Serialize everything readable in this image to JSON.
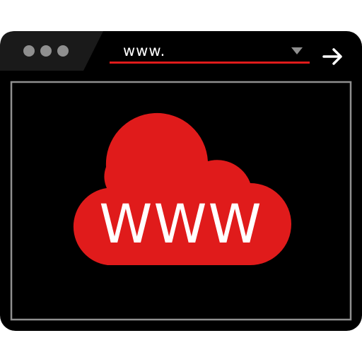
{
  "address_bar": {
    "url_value": "www.",
    "dropdown_icon": "triangle-down-icon",
    "go_icon": "arrow-right-icon"
  },
  "window_controls": {
    "icon": "three-dots-icon"
  },
  "content": {
    "cloud_icon": "cloud-icon",
    "cloud_label": "WWW"
  },
  "colors": {
    "frame": "#000000",
    "titlebar": "#1a1a1a",
    "accent": "#e01b1b",
    "dots": "#8f8f8f",
    "viewport_border": "#8f8f8f",
    "text": "#ffffff"
  }
}
